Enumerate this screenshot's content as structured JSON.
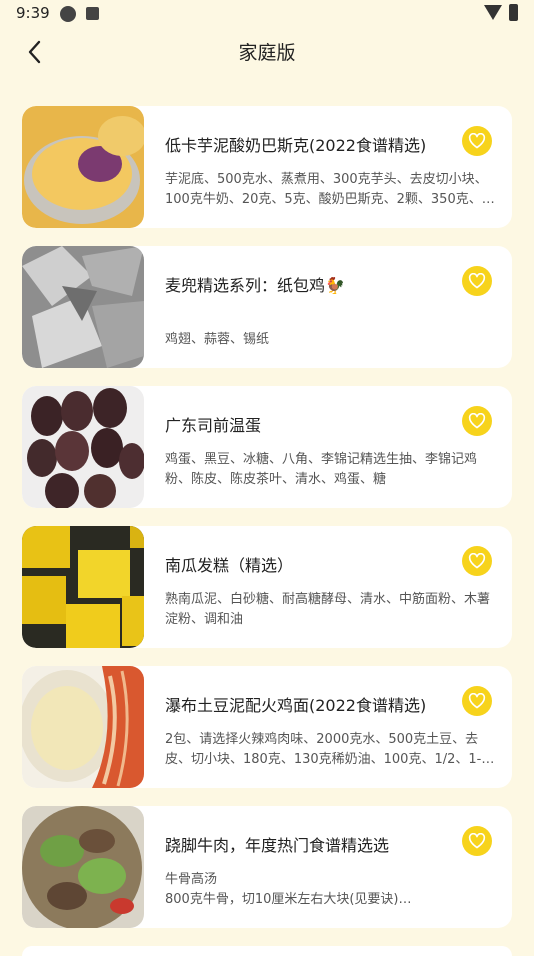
{
  "status_bar": {
    "time": "9:39"
  },
  "header": {
    "title": "家庭版"
  },
  "recipes": [
    {
      "title": "低卡芋泥酸奶巴斯克(2022食谱精选)",
      "ingredients": "芋泥底、500克水、蒸煮用、300克芋头、去皮切小块、100克牛奶、20克、5克、酸奶巴斯克、2颗、350克、…"
    },
    {
      "title": "麦兜精选系列：纸包鸡🐓",
      "ingredients": "鸡翅、蒜蓉、锡纸"
    },
    {
      "title": "广东司前温蛋",
      "ingredients": "鸡蛋、黑豆、冰糖、八角、李锦记精选生抽、李锦记鸡粉、陈皮、陈皮茶叶、清水、鸡蛋、糖"
    },
    {
      "title": "南瓜发糕（精选）",
      "ingredients": "熟南瓜泥、白砂糖、耐高糖酵母、清水、中筋面粉、木薯淀粉、调和油"
    },
    {
      "title": "瀑布土豆泥配火鸡面(2022食谱精选)",
      "ingredients": "2包、请选择火辣鸡肉味、2000克水、500克土豆、去皮、切小块、180克、130克稀奶油、100克、1/2、1-…"
    },
    {
      "title": "跷脚牛肉，年度热门食谱精选选",
      "ingredients": "牛骨高汤\n800克牛骨，切10厘米左右大块(见要诀)…"
    }
  ],
  "colors": {
    "background": "#fdf8e3",
    "card": "#ffffff",
    "favorite": "#f7d31c"
  },
  "icons": {
    "back": "chevron-left-icon",
    "favorite": "heart-icon"
  }
}
